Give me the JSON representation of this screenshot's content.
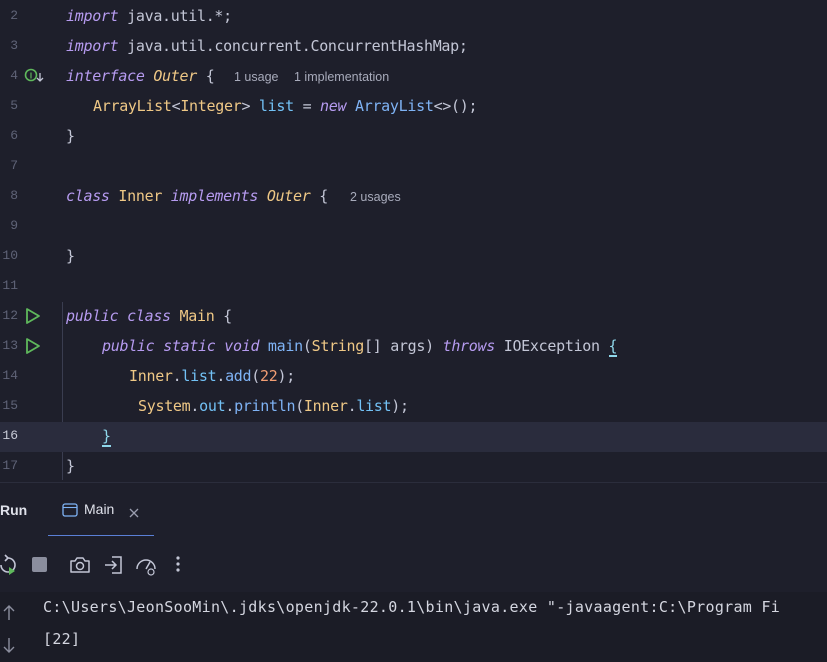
{
  "editor": {
    "current_line": "16",
    "lines": [
      {
        "num": "2",
        "t1": "import",
        "t2": " java.util.*;"
      },
      {
        "num": "3",
        "t1": "import",
        "t2": " java.util.concurrent.ConcurrentHashMap;"
      },
      {
        "num": "4",
        "t1": "interface",
        "t2": " ",
        "t3": "Outer",
        "t4": " {",
        "hint1": "1 usage",
        "hint2": "1 implementation"
      },
      {
        "num": "5",
        "t1": "ArrayList",
        "t2": "<",
        "t3": "Integer",
        "t4": "> ",
        "t5": "list",
        "t6": " = ",
        "t7": "new",
        "t8": " ",
        "t9": "ArrayList",
        "t10": "<>();"
      },
      {
        "num": "6",
        "t1": "}"
      },
      {
        "num": "7"
      },
      {
        "num": "8",
        "t1": "class",
        "t2": " ",
        "t3": "Inner",
        "t4": " ",
        "t5": "implements",
        "t6": " ",
        "t7": "Outer",
        "t8": " {",
        "hint1": "2 usages"
      },
      {
        "num": "9"
      },
      {
        "num": "10",
        "t1": "}"
      },
      {
        "num": "11"
      },
      {
        "num": "12",
        "t1": "public",
        "t2": " ",
        "t3": "class",
        "t4": " ",
        "t5": "Main",
        "t6": " {"
      },
      {
        "num": "13",
        "t1": "public",
        "t2": " ",
        "t3": "static",
        "t4": " ",
        "t5": "void",
        "t6": " ",
        "t7": "main",
        "t8": "(",
        "t9": "String",
        "t10": "[] ",
        "t11": "args",
        "t12": ") ",
        "t13": "throws",
        "t14": " ",
        "t15": "IOException",
        "t16": " ",
        "t17": "{"
      },
      {
        "num": "14",
        "t1": "Inner",
        "t2": ".",
        "t3": "list",
        "t4": ".",
        "t5": "add",
        "t6": "(",
        "t7": "22",
        "t8": ");"
      },
      {
        "num": "15",
        "t1": "System",
        "t2": ".",
        "t3": "out",
        "t4": ".",
        "t5": "println",
        "t6": "(",
        "t7": "Inner",
        "t8": ".",
        "t9": "list",
        "t10": ");"
      },
      {
        "num": "16",
        "t1": "}"
      },
      {
        "num": "17",
        "t1": "}"
      }
    ]
  },
  "run_panel": {
    "title": "Run",
    "tab_label": "Main",
    "toolbar": [
      "rerun-icon",
      "stop-icon",
      "camera-icon",
      "exit-icon",
      "gauge-icon",
      "more-vertical-icon"
    ],
    "console": [
      "C:\\Users\\JeonSooMin\\.jdks\\openjdk-22.0.1\\bin\\java.exe \"-javaagent:C:\\Program Fi",
      "[22]"
    ]
  },
  "colors": {
    "background": "#1e1f2b",
    "keyword": "#b69bf0",
    "type": "#efc886",
    "function": "#7fb3f5",
    "number": "#f29e74",
    "run_icon": "#5fb85c"
  }
}
